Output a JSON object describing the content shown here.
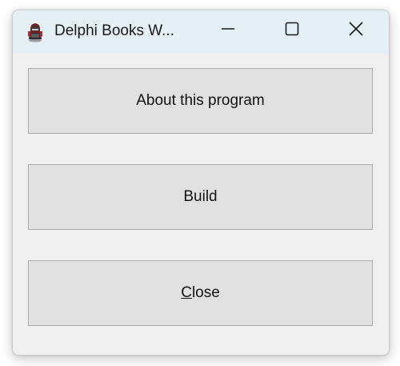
{
  "window": {
    "title": "Delphi Books W...",
    "icon": "delphi-helmet-icon"
  },
  "titlebar_controls": {
    "minimize": "minimize-icon",
    "maximize": "maximize-icon",
    "close": "close-icon"
  },
  "buttons": {
    "about": "About this program",
    "build": "Build",
    "close_accel": "C",
    "close_rest": "lose"
  },
  "colors": {
    "titlebar_bg": "#e4f0f6",
    "window_bg": "#f0f0f0",
    "button_bg": "#e1e1e1",
    "button_border": "#adadad"
  }
}
